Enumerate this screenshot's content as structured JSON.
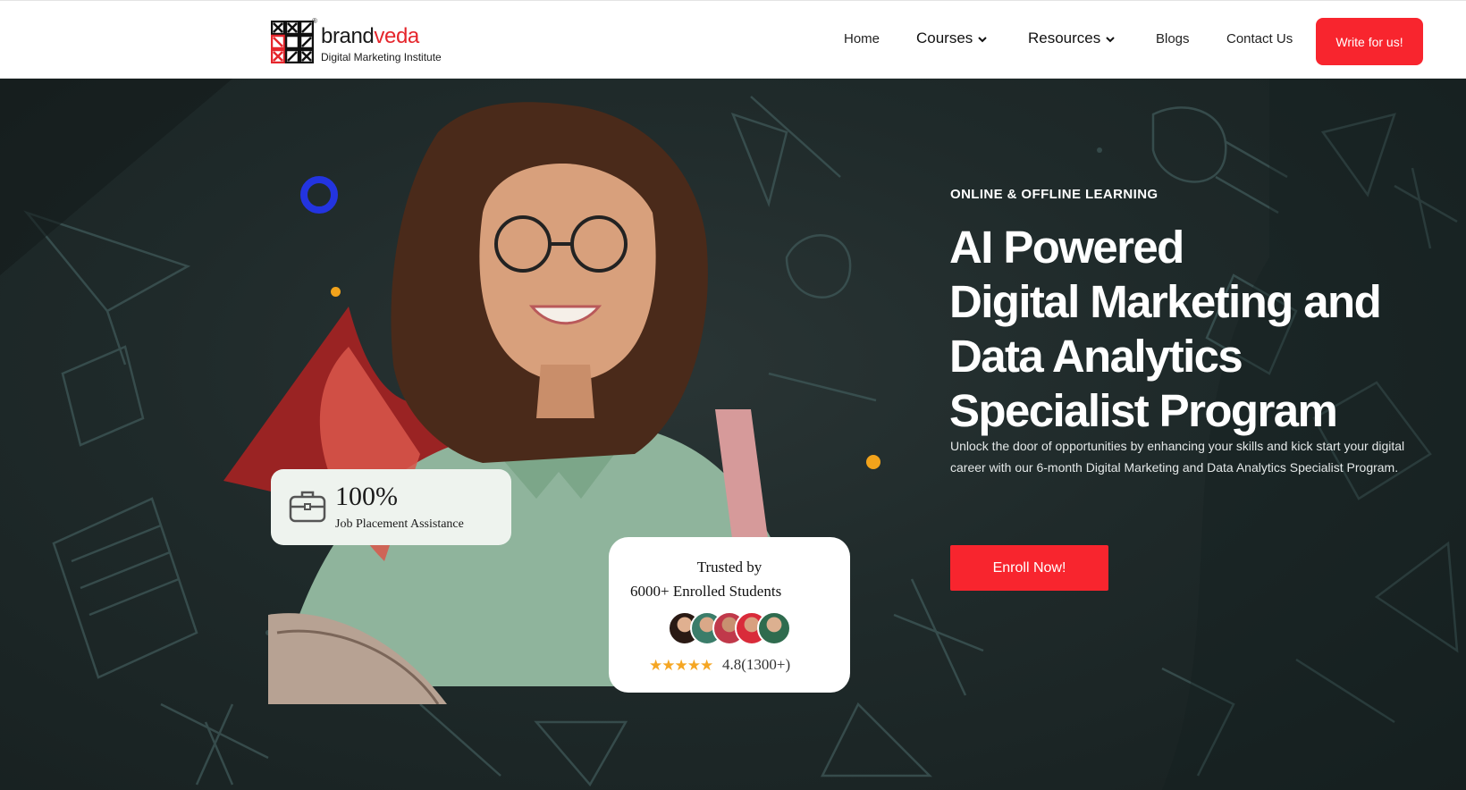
{
  "brand": {
    "name_part1": "brand",
    "name_part2": "veda",
    "registered": "®",
    "tagline": "Digital Marketing Institute"
  },
  "nav": {
    "home": "Home",
    "courses": "Courses",
    "resources": "Resources",
    "blogs": "Blogs",
    "contact": "Contact Us",
    "cta": "Write for us!"
  },
  "hero": {
    "eyebrow": "ONLINE & OFFLINE LEARNING",
    "headline": [
      "AI Powered",
      "Digital Marketing and",
      "Data Analytics",
      "Specialist Program"
    ],
    "description": "Unlock the door of opportunities by enhancing your skills and kick start your digital career with our 6-month Digital Marketing and Data Analytics Specialist Program.",
    "cta": "Enroll Now!"
  },
  "placement_card": {
    "value": "100%",
    "label": "Job Placement Assistance"
  },
  "trust_card": {
    "line1": "Trusted by",
    "line2": "6000+ Enrolled Students",
    "stars": "★★★★★",
    "rating": "4.8(1300+)"
  },
  "colors": {
    "accent_red": "#f8252e",
    "ring_blue": "#2334e0",
    "dot_yellow": "#f2a31b",
    "hero_bg": "#1f2a2a"
  },
  "icons": [
    "chevron-down-icon",
    "briefcase-icon",
    "star-icon"
  ]
}
